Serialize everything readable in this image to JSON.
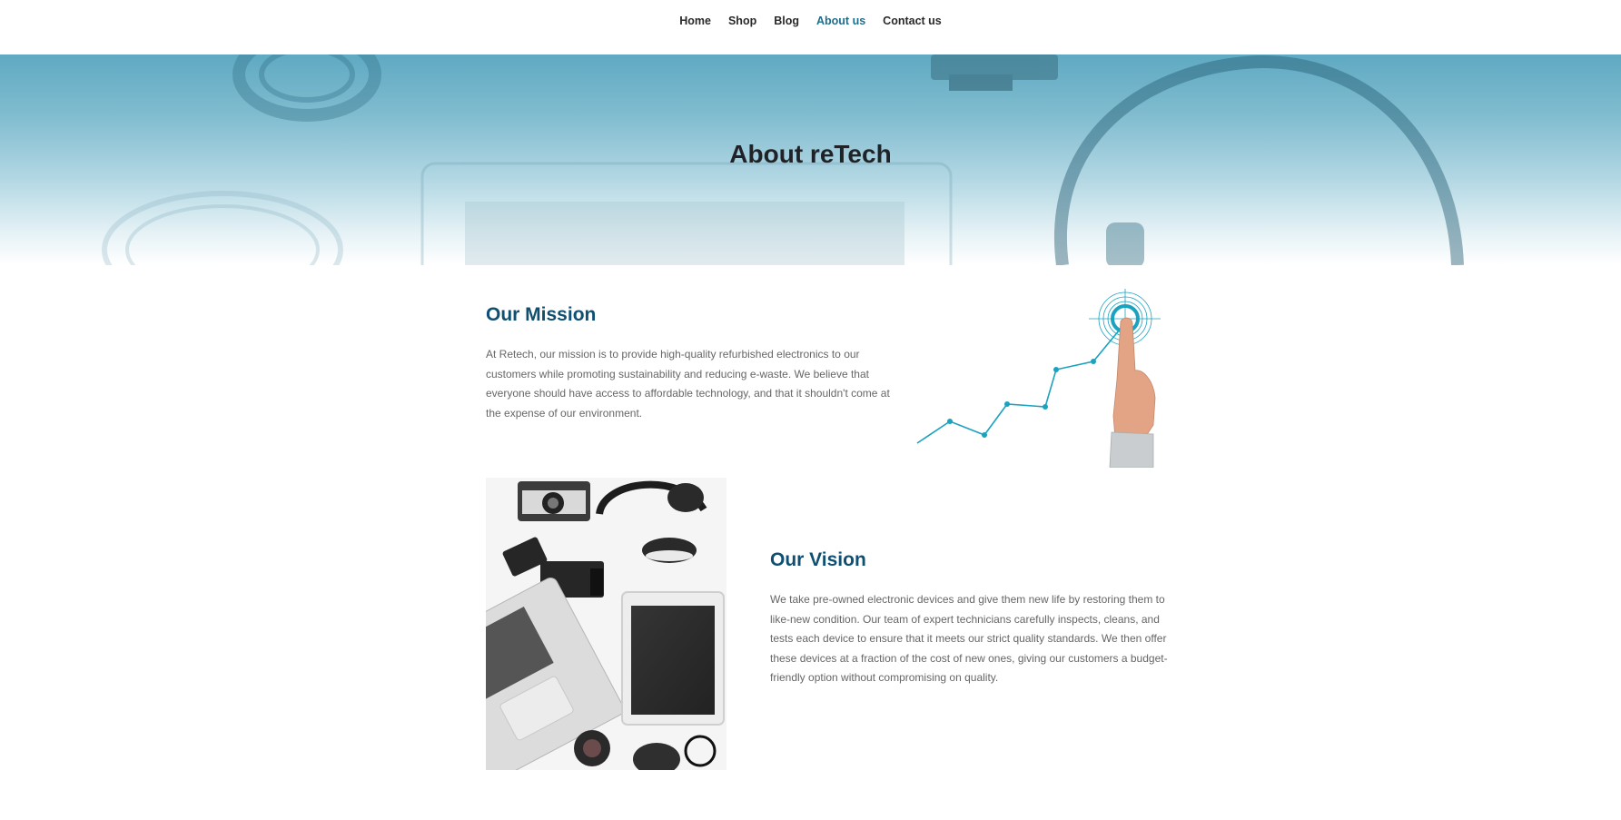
{
  "nav": {
    "items": [
      {
        "label": "Home",
        "active": false
      },
      {
        "label": "Shop",
        "active": false
      },
      {
        "label": "Blog",
        "active": false
      },
      {
        "label": "About us",
        "active": true
      },
      {
        "label": "Contact us",
        "active": false
      }
    ],
    "active_color": "#1e6d8c"
  },
  "hero": {
    "title": "About reTech"
  },
  "mission": {
    "title": "Our Mission",
    "text": "At Retech, our mission is to provide high-quality refurbished electronics to our customers while promoting sustainability and reducing e-waste. We believe that everyone should have access to affordable technology, and that it shouldn't come at the expense of our environment."
  },
  "vision": {
    "title": "Our Vision",
    "text": "We take pre-owned electronic devices and give them new life by restoring them to like-new condition. Our team of expert technicians carefully inspects, cleans, and tests each device to ensure that it meets our strict quality standards. We then offer these devices at a fraction of the cost of new ones, giving our customers a budget-friendly option without compromising on quality."
  },
  "colors": {
    "heading": "#0f4f72",
    "hero_tint": "#5fa9c2",
    "accent": "#1aa2bf"
  }
}
